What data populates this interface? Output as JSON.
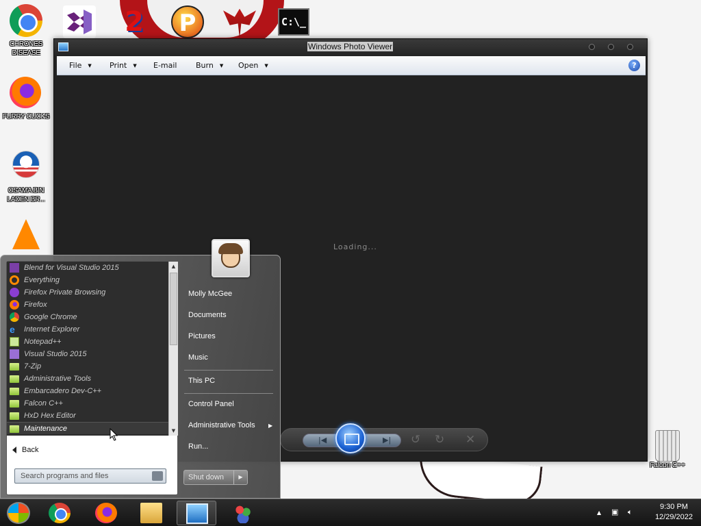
{
  "desktop": {
    "icons_left": [
      {
        "label": "CHRONES DISEASE"
      },
      {
        "label": "FURRY CUCKS"
      },
      {
        "label": "OSAMA BIN LADEN BR..."
      },
      {
        "label": ""
      }
    ],
    "recycle_bin": {
      "label": "Falcon C++"
    }
  },
  "photo_viewer": {
    "title": "Windows Photo Viewer",
    "menu": [
      {
        "label": "File",
        "dropdown": true
      },
      {
        "label": "Print",
        "dropdown": true
      },
      {
        "label": "E-mail",
        "dropdown": false
      },
      {
        "label": "Burn",
        "dropdown": true
      },
      {
        "label": "Open",
        "dropdown": true
      }
    ],
    "help": "?",
    "status": "Loading..."
  },
  "start_menu": {
    "programs": [
      {
        "label": "Blend for Visual Studio 2015",
        "icon": "blend-icon"
      },
      {
        "label": "Everything",
        "icon": "everything-icon"
      },
      {
        "label": "Firefox Private Browsing",
        "icon": "firefox-private-icon"
      },
      {
        "label": "Firefox",
        "icon": "firefox-icon"
      },
      {
        "label": "Google Chrome",
        "icon": "chrome-icon"
      },
      {
        "label": "Internet Explorer",
        "icon": "ie-icon"
      },
      {
        "label": "Notepad++",
        "icon": "notepadpp-icon"
      },
      {
        "label": "Visual Studio 2015",
        "icon": "visual-studio-icon"
      },
      {
        "label": "7-Zip",
        "icon": "folder-icon"
      },
      {
        "label": "Administrative Tools",
        "icon": "folder-icon"
      },
      {
        "label": "Embarcadero Dev-C++",
        "icon": "folder-icon"
      },
      {
        "label": "Falcon C++",
        "icon": "folder-icon"
      },
      {
        "label": "HxD Hex Editor",
        "icon": "folder-icon"
      },
      {
        "label": "Maintenance",
        "icon": "folder-icon",
        "selected": true
      }
    ],
    "back_label": "Back",
    "search_placeholder": "Search programs and files",
    "right_links": {
      "user": "Molly McGee",
      "documents": "Documents",
      "pictures": "Pictures",
      "music": "Music",
      "this_pc": "This PC",
      "control_panel": "Control Panel",
      "admin_tools": "Administrative Tools",
      "run": "Run..."
    },
    "shutdown_label": "Shut down"
  },
  "taskbar": {
    "clock_time": "9:30 PM",
    "clock_date": "12/29/2022"
  }
}
